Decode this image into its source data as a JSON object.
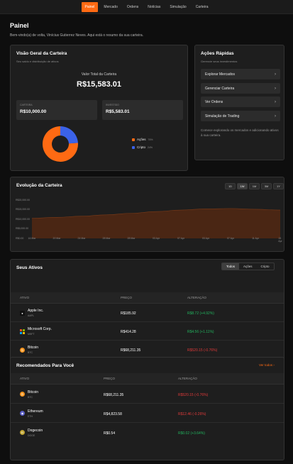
{
  "nav": {
    "items": [
      "Painel",
      "Mercado",
      "Ordens",
      "Notícias",
      "Simulação",
      "Carteira"
    ]
  },
  "page": {
    "title": "Painel",
    "welcome": "Bem-vindo(a) de volta, Vinícius Gutierrez Neves. Aqui está o resumo da sua carteira."
  },
  "overview": {
    "title": "Visão Geral da Carteira",
    "subtitle": "Seu saldo e distribuição de ativos",
    "total_label": "Valor Total da Carteira",
    "total_value": "R$15,583.01",
    "cash_label": "CARTEIRA",
    "cash_value": "R$10,000.00",
    "invested_label": "INVESTIDO",
    "invested_value": "R$5,583.01",
    "legend": [
      {
        "name": "Ações",
        "pct": "76%",
        "value": 76,
        "color": "#ff6a13"
      },
      {
        "name": "Cripto",
        "pct": "24%",
        "value": 24,
        "color": "#3b62e8"
      }
    ]
  },
  "quick": {
    "title": "Ações Rápidas",
    "subtitle": "Gerencie seus investimentos",
    "items": [
      "Explorar Mercados",
      "Gerenciar Carteira",
      "Ver Ordens",
      "Simulação de Trading"
    ],
    "note": "Comece explorando os mercados e adicionando ativos à sua carteira."
  },
  "evolution": {
    "title": "Evolução da Carteira",
    "ranges": [
      "1D",
      "1W",
      "1M",
      "3M",
      "1Y"
    ],
    "active_range": "1W",
    "y_ticks": [
      "R$20,000.00",
      "R$15,000.00",
      "R$10,000.00",
      "R$5,000.00",
      "R$0.00"
    ],
    "x_ticks": [
      "16 Mar",
      "20 Mar",
      "24 Mar",
      "28 Mar",
      "28 Mar",
      "03 Apr",
      "07 Apr",
      "03 Apr",
      "07 Apr",
      "11 Apr",
      "15 Apr"
    ]
  },
  "chart_data": {
    "type": "area",
    "title": "Evolução da Carteira",
    "x": [
      "16 Mar",
      "20 Mar",
      "24 Mar",
      "28 Mar",
      "28 Mar",
      "03 Apr",
      "07 Apr",
      "03 Apr",
      "07 Apr",
      "11 Apr",
      "15 Apr"
    ],
    "values": [
      10500,
      11000,
      11600,
      12300,
      13100,
      14000,
      14800,
      15400,
      15600,
      15200,
      14800
    ],
    "ylim": [
      0,
      20000
    ],
    "grid": false,
    "color": "#5a2a12"
  },
  "assets": {
    "title": "Seus Ativos",
    "filters": [
      "Todos",
      "Ações",
      "Cripto"
    ],
    "active_filter": "Todos",
    "columns": [
      "ATIVO",
      "PREÇO",
      "ALTERAÇÃO"
    ],
    "rows": [
      {
        "name": "Apple Inc.",
        "symbol": "AAPL",
        "price": "R$185.92",
        "change": "R$8.72 (+4.92%)",
        "dir": "up",
        "icon": "apple-icon"
      },
      {
        "name": "Microsoft Corp.",
        "symbol": "MSFT",
        "price": "R$414.28",
        "change": "R$4.56 (+1.11%)",
        "dir": "up",
        "icon": "microsoft-icon"
      },
      {
        "name": "Bitcoin",
        "symbol": "BTC",
        "price": "R$68,211.35",
        "change": "R$520.15 (-0.76%)",
        "dir": "down",
        "icon": "bitcoin-icon"
      }
    ]
  },
  "recommended": {
    "title": "Recomendados Para Você",
    "see_all": "Ver todos",
    "columns": [
      "ATIVO",
      "PREÇO",
      "ALTERAÇÃO"
    ],
    "rows": [
      {
        "name": "Bitcoin",
        "symbol": "BTC",
        "price": "R$68,211.35",
        "change": "R$520.15 (-0.76%)",
        "dir": "down",
        "icon": "bitcoin-icon"
      },
      {
        "name": "Ethereum",
        "symbol": "ETH",
        "price": "R$4,823.58",
        "change": "R$12.46 (-0.26%)",
        "dir": "down",
        "icon": "ethereum-icon"
      },
      {
        "name": "Dogecoin",
        "symbol": "DOGE",
        "price": "R$0.54",
        "change": "R$0.02 (+3.64%)",
        "dir": "up",
        "icon": "dogecoin-icon"
      }
    ]
  }
}
